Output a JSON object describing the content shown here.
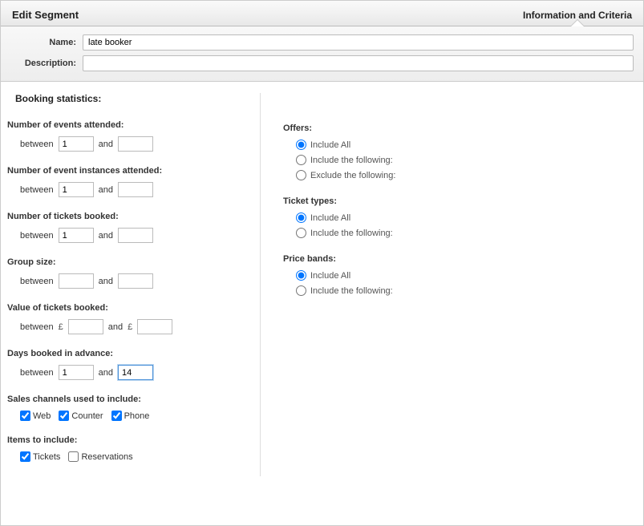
{
  "header": {
    "title": "Edit Segment",
    "active_tab": "Information and Criteria"
  },
  "fields": {
    "name_label": "Name:",
    "name_value": "late booker",
    "desc_label": "Description:",
    "desc_value": ""
  },
  "booking_stats_heading": "Booking statistics:",
  "between_label": "between",
  "and_label": "and",
  "currency_symbol": "£",
  "criteria": {
    "events_attended": {
      "label": "Number of events attended:",
      "from": "1",
      "to": ""
    },
    "instances_attended": {
      "label": "Number of event instances attended:",
      "from": "1",
      "to": ""
    },
    "tickets_booked": {
      "label": "Number of tickets booked:",
      "from": "1",
      "to": ""
    },
    "group_size": {
      "label": "Group size:",
      "from": "",
      "to": ""
    },
    "value_booked": {
      "label": "Value of tickets booked:",
      "from": "",
      "to": ""
    },
    "days_advance": {
      "label": "Days booked in advance:",
      "from": "1",
      "to": "14"
    }
  },
  "sales_channels": {
    "heading": "Sales channels used to include:",
    "options": {
      "web": "Web",
      "counter": "Counter",
      "phone": "Phone"
    },
    "web_checked": true,
    "counter_checked": true,
    "phone_checked": true
  },
  "items_include": {
    "heading": "Items to include:",
    "options": {
      "tickets": "Tickets",
      "reservations": "Reservations"
    },
    "tickets_checked": true,
    "reservations_checked": false
  },
  "right": {
    "offers": {
      "heading": "Offers:",
      "include_all": "Include All",
      "include_following": "Include the following:",
      "exclude_following": "Exclude the following:"
    },
    "ticket_types": {
      "heading": "Ticket types:",
      "include_all": "Include All",
      "include_following": "Include the following:"
    },
    "price_bands": {
      "heading": "Price bands:",
      "include_all": "Include All",
      "include_following": "Include the following:"
    }
  }
}
